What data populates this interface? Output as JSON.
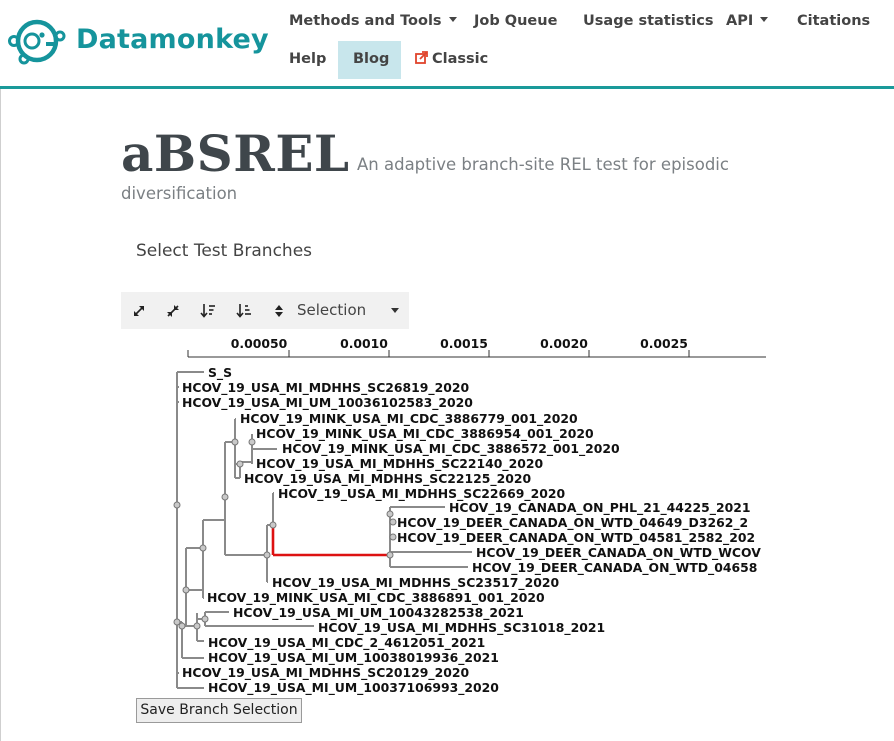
{
  "brand": {
    "name": "Datamonkey",
    "color": "#15949c"
  },
  "nav": {
    "methods": "Methods and Tools",
    "queue": "Job Queue",
    "usage": "Usage statistics",
    "api": "API",
    "citations": "Citations",
    "help": "Help",
    "blog": "Blog",
    "classic": "Classic"
  },
  "page": {
    "title": "aBSREL",
    "subtitle_line1": "An adaptive branch-site REL test for episodic",
    "subtitle_line2": "diversification",
    "section_title": "Select Test Branches"
  },
  "toolbar": {
    "selection_label": "Selection",
    "icons": [
      "expand-icon",
      "compress-icon",
      "sort-descending-icon",
      "sort-ascending-icon",
      "sort-toggle-icon"
    ]
  },
  "tree": {
    "axis_ticks": [
      "0.00050",
      "0.0010",
      "0.0015",
      "0.0020",
      "0.0025"
    ],
    "selected_branch_color": "#dd1111",
    "leaves": [
      "S_S",
      "HCOV_19_USA_MI_MDHHS_SC26819_2020",
      "HCOV_19_USA_MI_UM_10036102583_2020",
      "HCOV_19_MINK_USA_MI_CDC_3886779_001_2020",
      "HCOV_19_MINK_USA_MI_CDC_3886954_001_2020",
      "HCOV_19_MINK_USA_MI_CDC_3886572_001_2020",
      "HCOV_19_USA_MI_MDHHS_SC22140_2020",
      "HCOV_19_USA_MI_MDHHS_SC22125_2020",
      "HCOV_19_USA_MI_MDHHS_SC22669_2020",
      "HCOV_19_CANADA_ON_PHL_21_44225_2021",
      "HCOV_19_DEER_CANADA_ON_WTD_04649_D3262_2",
      "HCOV_19_DEER_CANADA_ON_WTD_04581_2582_202",
      "HCOV_19_DEER_CANADA_ON_WTD_WCOV",
      "HCOV_19_DEER_CANADA_ON_WTD_04658",
      "HCOV_19_USA_MI_MDHHS_SC23517_2020",
      "HCOV_19_MINK_USA_MI_CDC_3886891_001_2020",
      "HCOV_19_USA_MI_UM_10043282538_2021",
      "HCOV_19_USA_MI_MDHHS_SC31018_2021",
      "HCOV_19_USA_MI_CDC_2_4612051_2021",
      "HCOV_19_USA_MI_UM_10038019936_2021",
      "HCOV_19_USA_MI_MDHHS_SC20129_2020",
      "HCOV_19_USA_MI_UM_10037106993_2020"
    ]
  },
  "save_button": "Save Branch Selection"
}
